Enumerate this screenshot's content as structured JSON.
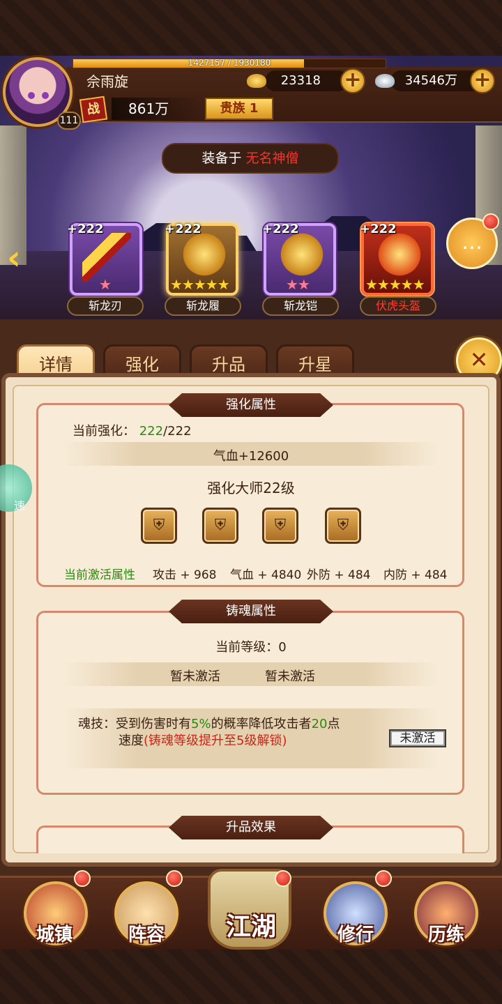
{
  "player": {
    "name": "佘雨旋",
    "level": "111",
    "xp_text": "1427157 / 1930180",
    "xp_fraction": 0.739,
    "battle_label": "战",
    "power": "861万",
    "noble": "贵族 1"
  },
  "resources": {
    "gold": "23318",
    "silver": "34546万"
  },
  "equipped_prefix": "装备于",
  "equipped_hero": "无名神僧",
  "slots": [
    {
      "plus": "+222",
      "name": "斩龙刃",
      "stars": "★",
      "star_count": 1
    },
    {
      "plus": "+222",
      "name": "斩龙履",
      "stars": "★★★★★",
      "star_count": 5
    },
    {
      "plus": "+222",
      "name": "斩龙铠",
      "stars": "★★",
      "star_count": 2
    },
    {
      "plus": "+222",
      "name": "伏虎头盔",
      "stars": "★★★★★",
      "star_count": 5
    }
  ],
  "tabs": [
    "详情",
    "强化",
    "升品",
    "升星"
  ],
  "close_label": "✕",
  "enhance": {
    "title": "强化属性",
    "current_label": "当前强化：",
    "current_value": "222",
    "current_max": "/222",
    "hp_bonus": "气血+12600",
    "master": "强化大师22级",
    "active_label": "当前激活属性",
    "stats": [
      "攻击 + 968",
      "气血 + 4840",
      "外防 + 484",
      "内防 + 484"
    ]
  },
  "soul": {
    "title": "铸魂属性",
    "level_line": "当前等级：0",
    "inactive_a": "暂未激活",
    "inactive_b": "暂未激活",
    "skill_prefix": "魂技：受到伤害时有",
    "skill_pct": "5%",
    "skill_mid": "的概率降低攻击者",
    "skill_pts": "20",
    "skill_suffix": "点",
    "skill_line2_a": "速度",
    "skill_line2_b": "(铸魂等级提升至5级解锁)",
    "button": "未激活"
  },
  "upgrade": {
    "title": "升品效果"
  },
  "speed_label": "速",
  "nav": [
    "城镇",
    "阵容",
    "江湖",
    "修行",
    "历练"
  ],
  "colors": {
    "accent": "#e09a1a",
    "green": "#2a8a10",
    "red": "#c8281a"
  }
}
